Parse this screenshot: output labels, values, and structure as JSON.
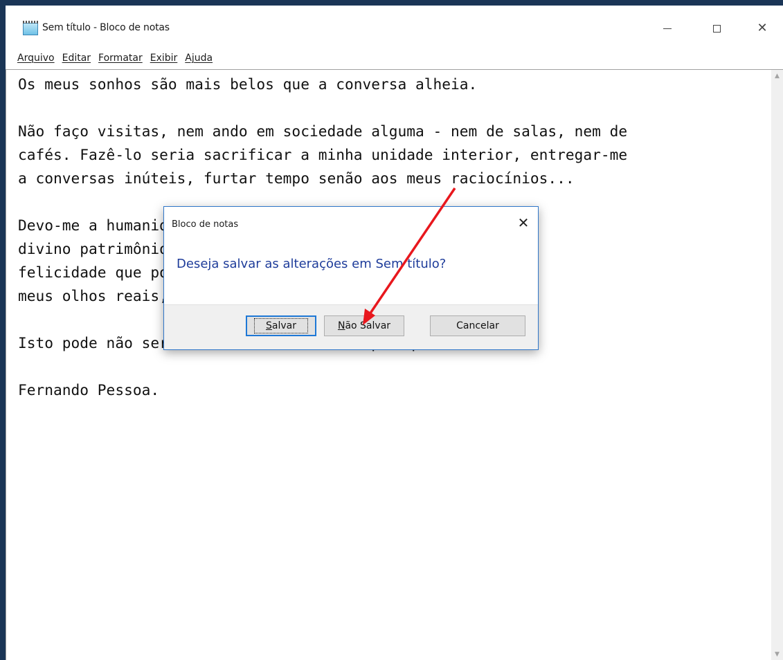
{
  "window": {
    "title": "Sem título - Bloco de notas",
    "controls": {
      "minimize": "—",
      "maximize": "☐",
      "close": "✕"
    }
  },
  "menu": {
    "items": [
      {
        "label": "Arquivo"
      },
      {
        "label": "Editar"
      },
      {
        "label": "Formatar"
      },
      {
        "label": "Exibir"
      },
      {
        "label": "Ajuda"
      }
    ]
  },
  "editor": {
    "text": "Os meus sonhos são mais belos que a conversa alheia.\n\nNão faço visitas, nem ando em sociedade alguma - nem de salas, nem de\ncafés. Fazê-lo seria sacrificar a minha unidade interior, entregar-me\na conversas inúteis, furtar tempo senão aos meus raciocínios...\n\nDevo-me a humanidade futura. Quanto desperdiço do\ndivino patrimônio que me foi dado, diminuo-lhes a\nfelicidade que possuem, que é ela-própria, não só aos\nmeus olhos reais, mas aos delas.\n\nIsto pode não ser verdade, mas sinto-o, por que crê-lo.\n\nFernando Pessoa."
  },
  "dialog": {
    "title": "Bloco de notas",
    "close": "✕",
    "message": "Deseja salvar as alterações em Sem título?",
    "buttons": {
      "save_mnemonic": "S",
      "save_rest": "alvar",
      "dont_save_mnemonic": "N",
      "dont_save_rest": "ão Salvar",
      "cancel": "Cancelar"
    }
  },
  "annotation": {
    "arrow_color": "#e8171d"
  }
}
